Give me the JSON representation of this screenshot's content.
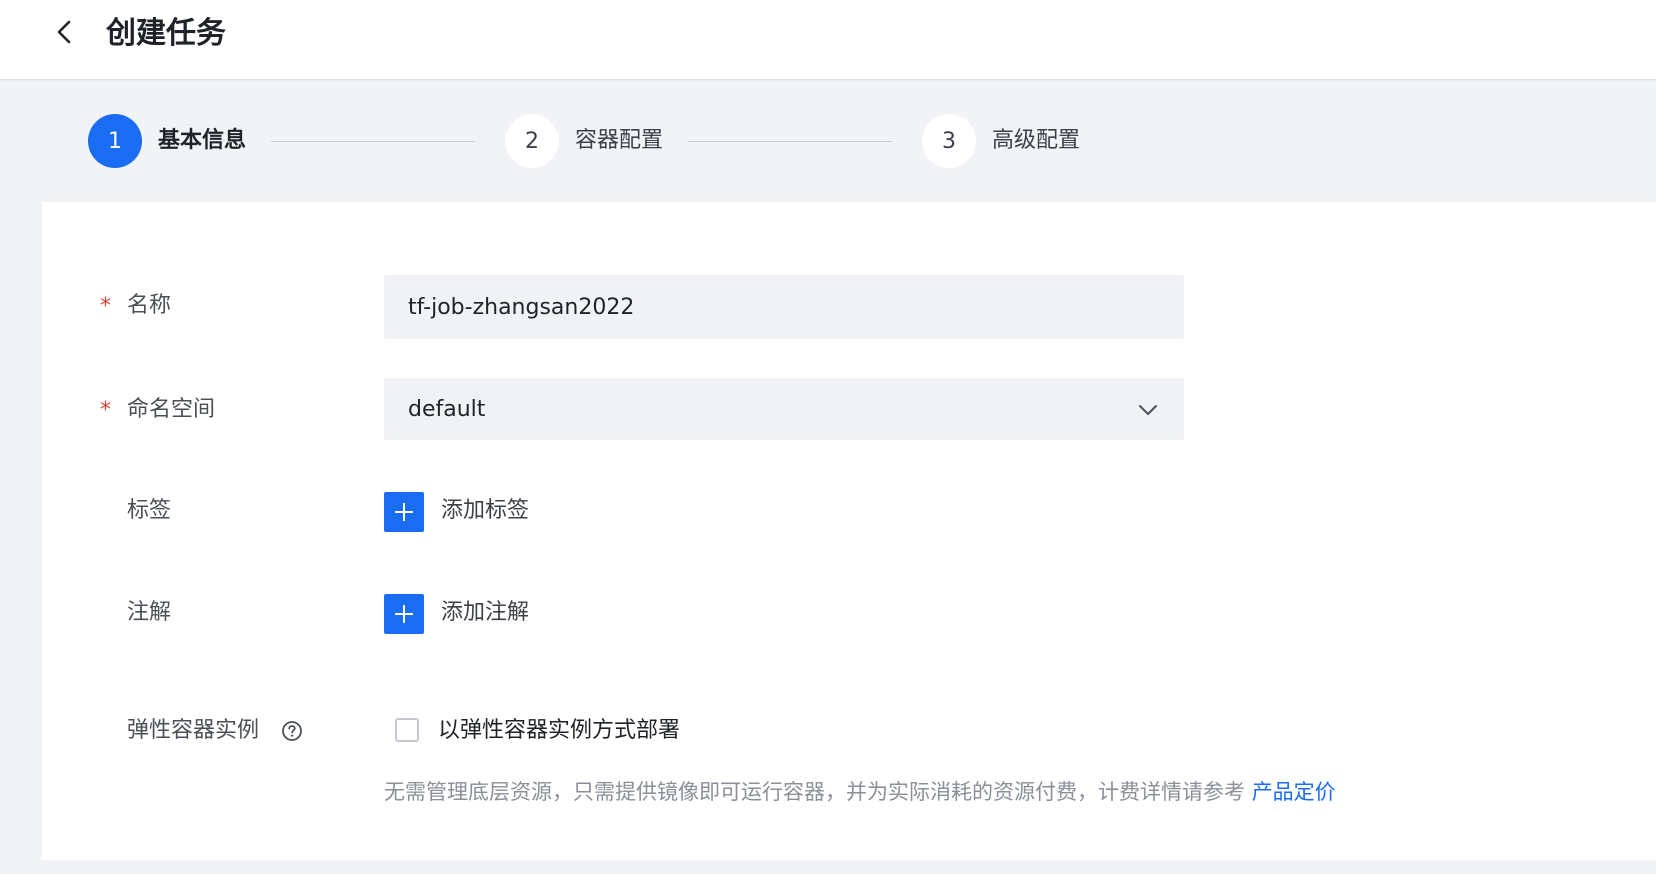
{
  "header": {
    "title": "创建任务",
    "back_icon": "chevron-left-icon"
  },
  "steps": [
    {
      "number": "1",
      "label": "基本信息",
      "active": true
    },
    {
      "number": "2",
      "label": "容器配置",
      "active": false
    },
    {
      "number": "3",
      "label": "高级配置",
      "active": false
    }
  ],
  "form": {
    "name": {
      "label": "名称",
      "required_mark": "*",
      "value": "tf-job-zhangsan2022"
    },
    "namespace": {
      "label": "命名空间",
      "required_mark": "*",
      "selected": "default",
      "icon": "chevron-down-icon"
    },
    "labels": {
      "label": "标签",
      "add_text": "添加标签",
      "icon": "plus-icon"
    },
    "annotations": {
      "label": "注解",
      "add_text": "添加注解",
      "icon": "plus-icon"
    },
    "elastic": {
      "label": "弹性容器实例",
      "help_icon": "question-circle-icon",
      "checkbox_label": "以弹性容器实例方式部署",
      "checked": false,
      "description": "无需管理底层资源，只需提供镜像即可运行容器，并为实际消耗的资源付费，计费详情请参考",
      "link_text": "产品定价"
    }
  },
  "colors": {
    "primary": "#1a6cf3",
    "required": "#e54545",
    "page_bg": "#f2f3f7",
    "input_bg": "#f1f2f6"
  }
}
